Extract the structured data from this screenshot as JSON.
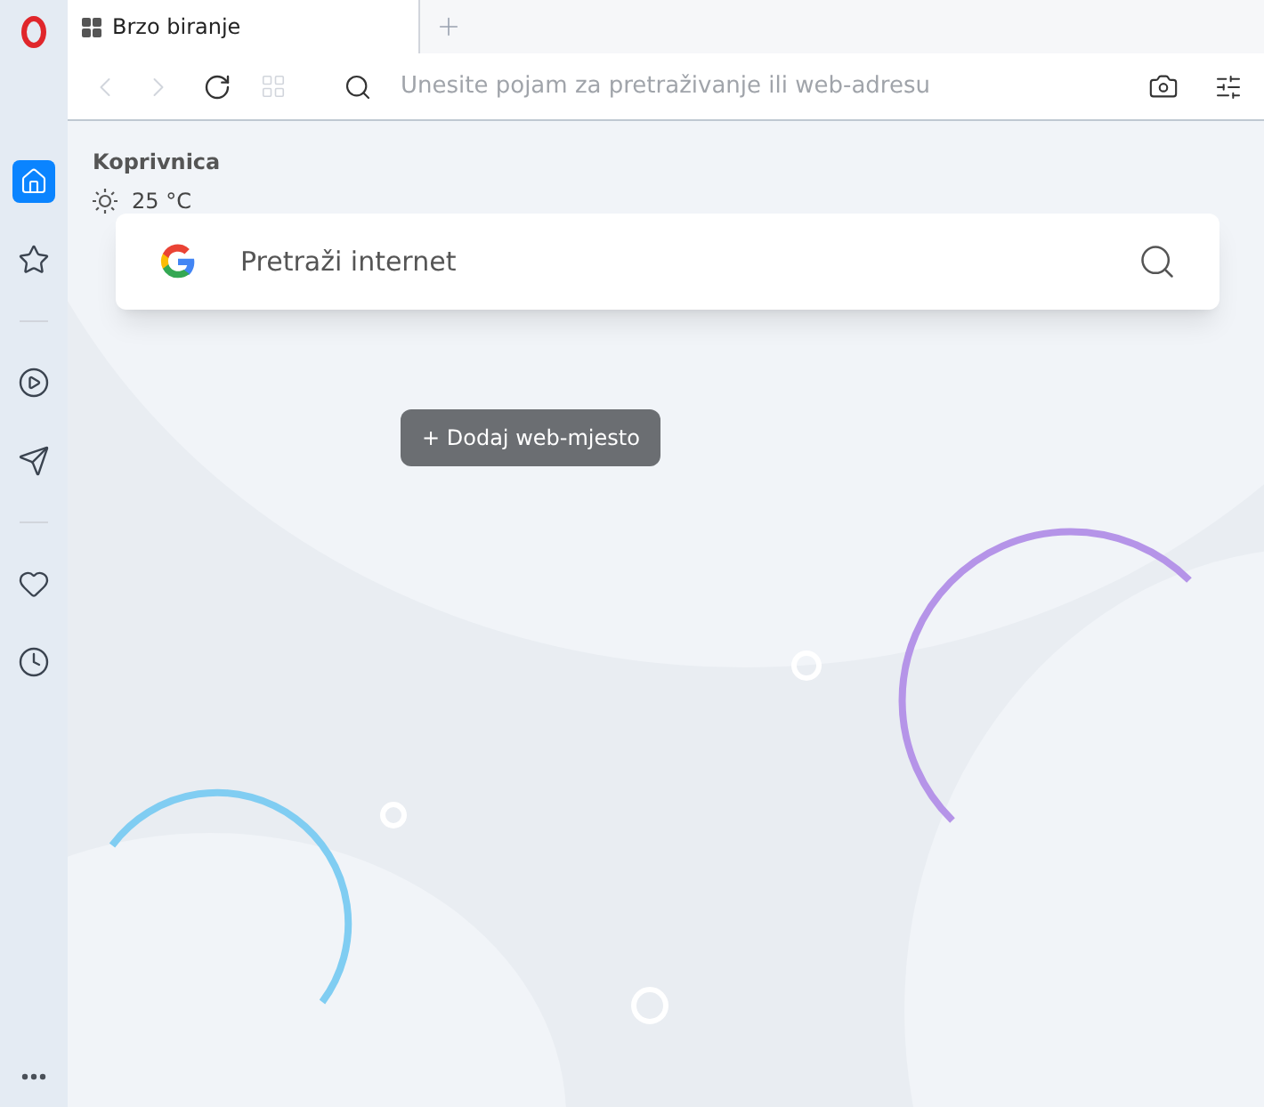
{
  "tab": {
    "title": "Brzo biranje",
    "selected": true
  },
  "address_bar": {
    "placeholder": "Unesite pojam za pretraživanje ili web-adresu"
  },
  "weather": {
    "city": "Koprivnica",
    "temperature": "25 °C"
  },
  "search": {
    "placeholder": "Pretraži internet"
  },
  "add_site_button": "+ Dodaj web-mjesto",
  "sidebar": {
    "items": [
      {
        "kind": "home",
        "selected": true
      },
      {
        "kind": "star",
        "selected": false
      },
      {
        "kind": "divider"
      },
      {
        "kind": "player",
        "selected": false
      },
      {
        "kind": "send",
        "selected": false
      },
      {
        "kind": "divider"
      },
      {
        "kind": "heart",
        "selected": false
      },
      {
        "kind": "clock",
        "selected": false
      }
    ]
  }
}
